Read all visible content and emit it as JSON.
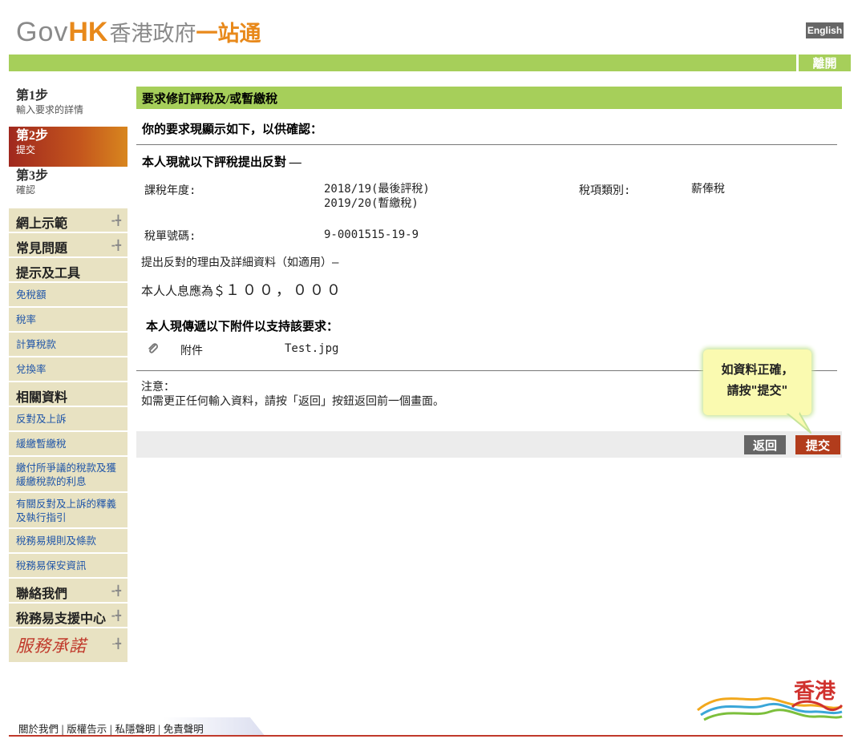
{
  "header": {
    "logo_gov": "Gov",
    "logo_hk": "HK",
    "logo_cn_1": "香港政府",
    "logo_cn_2": "一站通",
    "language_button": "English",
    "logout_button": "離開"
  },
  "sidebar": {
    "steps": [
      {
        "title": "第1步",
        "subtitle": "輸入要求的詳情"
      },
      {
        "title": "第2步",
        "subtitle": "提交"
      },
      {
        "title": "第3步",
        "subtitle": "確認"
      }
    ],
    "nav": {
      "demo": "網上示範",
      "faq": "常見問題",
      "tips_tools": "提示及工具",
      "allowances": "免稅額",
      "tax_rates": "稅率",
      "calc_tax": "計算稅款",
      "exchange_rate": "兌換率",
      "related_info": "相關資料",
      "objection_appeal": "反對及上訴",
      "holdover": "緩繳暫繳稅",
      "dispute_tax": "繳付所爭議的稅款及獲緩繳稅款的利息",
      "dipn": "有關反對及上訴的釋義及執行指引",
      "rules": "稅務易規則及條款",
      "security": "稅務易保安資訊",
      "contact_us": "聯絡我們",
      "support_centre": "稅務易支援中心",
      "pledge": "服務承諾"
    }
  },
  "main": {
    "title": "要求修訂評稅及/或暫繳稅",
    "confirm_heading": "你的要求現顯示如下，以供確認：",
    "objection_heading": "本人現就以下評稅提出反對 —",
    "year_label": "課稅年度:",
    "year_value_1": "2018/19(最後評稅)",
    "year_value_2": "2019/20(暫繳稅)",
    "tax_type_label": "稅項類別:",
    "tax_type_value": "薪俸稅",
    "assessment_no_label": "稅單號碼:",
    "assessment_no_value": "9-0001515-19-9",
    "reason_label": "提出反對的理由及詳細資料（如適用）—",
    "reason_prefix": "本人人息應為＄",
    "reason_amount": "１００，０００",
    "attach_heading": "本人現傳遞以下附件以支持該要求：",
    "attach_label": "附件",
    "attach_file": "Test.jpg",
    "note_label": "注意：",
    "note_text": "如需更正任何輸入資料，請按「返回」按鈕返回前一個畫面。",
    "back_button": "返回",
    "submit_button": "提交",
    "tooltip_line_1": "如資料正確，",
    "tooltip_line_2": "請按\"提交\""
  },
  "footer": {
    "links": [
      "關於我們",
      "版權告示",
      "私隱聲明",
      "免責聲明"
    ],
    "brand": "香港"
  },
  "colors": {
    "green": "#a6cf5a",
    "orange": "#e8891b",
    "submit": "#b23c1c",
    "nav_bg": "#e8e2c2"
  }
}
